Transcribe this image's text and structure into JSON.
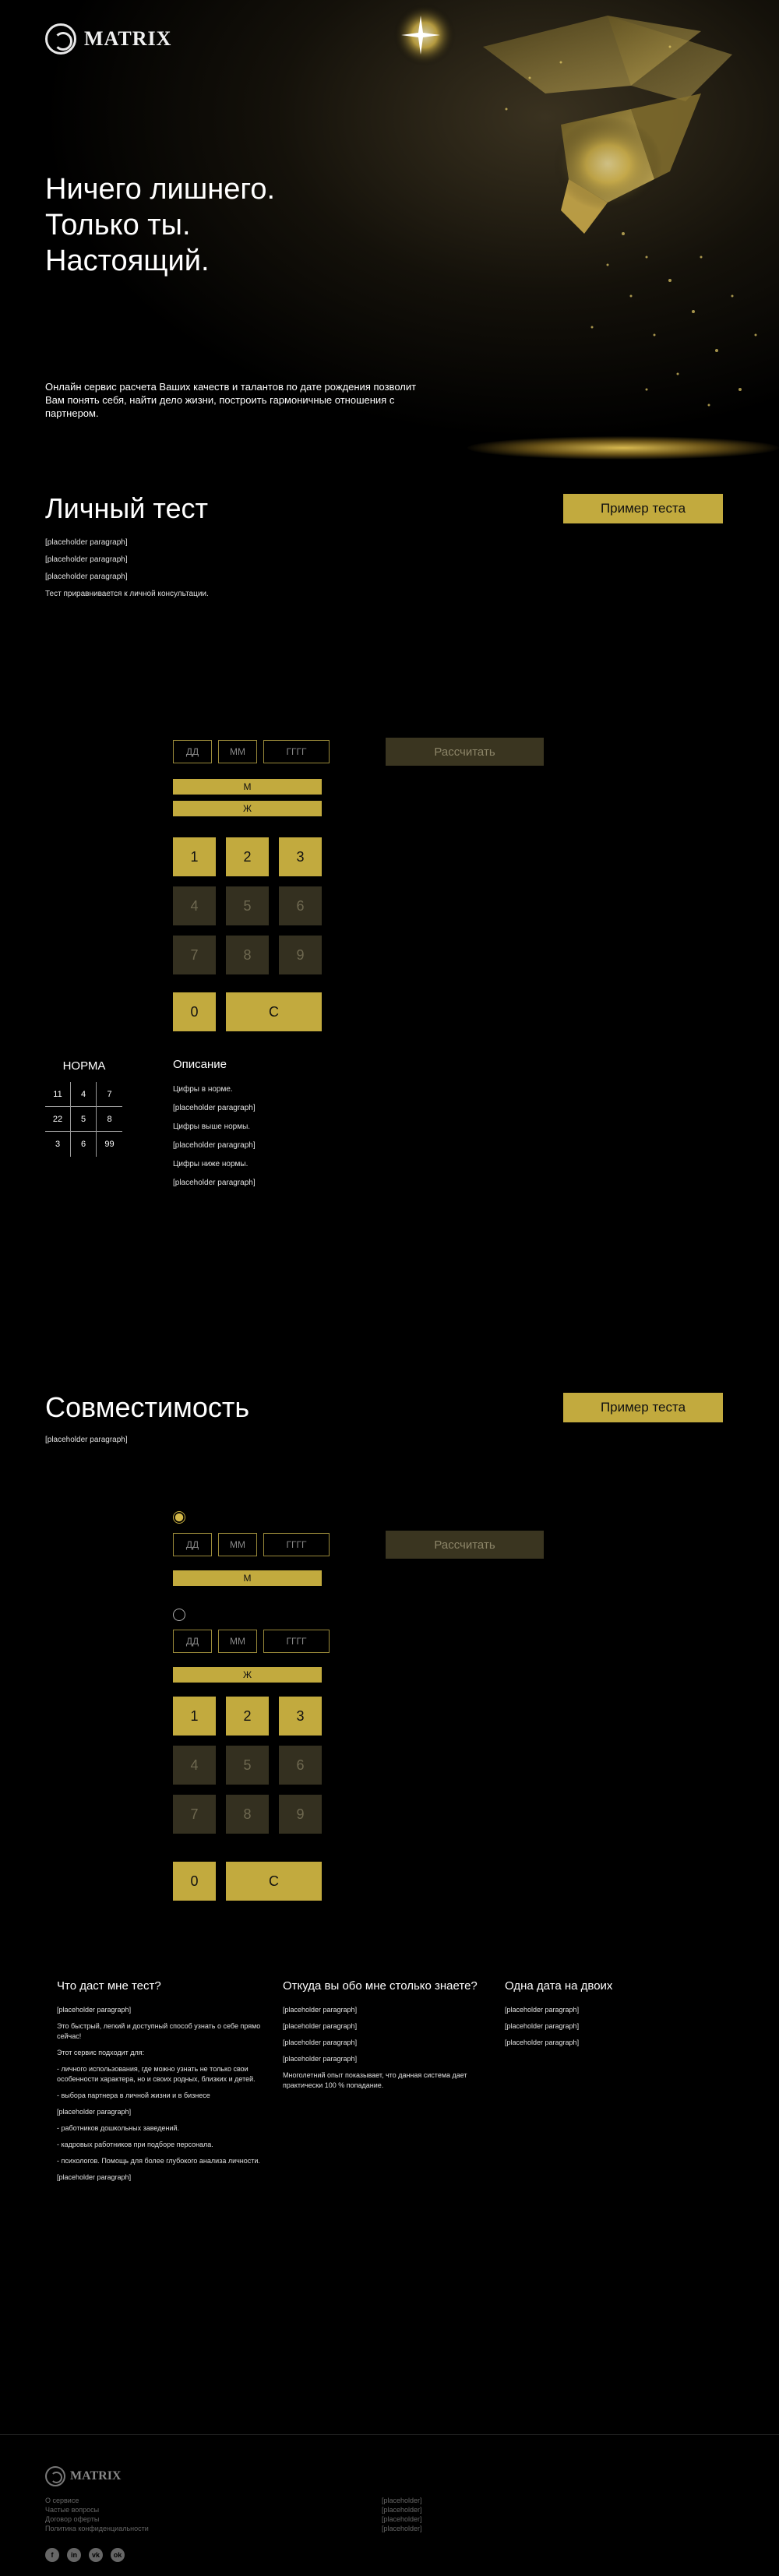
{
  "brand": {
    "name": "MATRIX"
  },
  "hero": {
    "title_lines": [
      "Ничего лишнего.",
      "Только ты.",
      "Настоящий."
    ],
    "subtitle": "Онлайн сервис расчета Ваших качеств и талантов по дате рождения позволит Вам понять себя, найти дело жизни, построить гармоничные отношения с партнером."
  },
  "personal_test": {
    "title": "Личный тест",
    "example_button": "Пример теста",
    "paragraphs": [
      "[placeholder paragraph]",
      "[placeholder paragraph]",
      "[placeholder paragraph]",
      "Тест приравнивается к личной консультации."
    ]
  },
  "calculator": {
    "day_placeholder": "ДД",
    "month_placeholder": "ММ",
    "year_placeholder": "ГГГГ",
    "calc_button": "Рассчитать",
    "male": "М",
    "female": "Ж",
    "keys": [
      "1",
      "2",
      "3",
      "4",
      "5",
      "6",
      "7",
      "8",
      "9"
    ],
    "zero": "0",
    "clear": "C"
  },
  "norma": {
    "title": "НОРМА",
    "cells": [
      "11",
      "4",
      "7",
      "22",
      "5",
      "8",
      "3",
      "6",
      "99"
    ]
  },
  "description": {
    "title": "Описание",
    "items": [
      "Цифры в норме.",
      "[placeholder paragraph]",
      "Цифры выше нормы.",
      "[placeholder paragraph]",
      "Цифры ниже нормы.",
      "[placeholder paragraph]"
    ]
  },
  "compatibility": {
    "title": "Совместимость",
    "example_button": "Пример теста",
    "text": "[placeholder paragraph]"
  },
  "columns": [
    {
      "title": "Что даст мне тест?",
      "paragraphs": [
        "[placeholder paragraph]",
        "Это быстрый, легкий и доступный способ узнать о себе прямо сейчас!",
        "Этот сервис подходит для:",
        "- личного использования, где можно узнать не только свои особенности характера, но и своих родных, близких и детей.",
        "- выбора партнера в личной жизни и в бизнесе",
        "[placeholder paragraph]",
        "- работников дошкольных заведений.",
        "- кадровых работников при подборе персонала.",
        "- психологов. Помощь для более глубокого анализа личности.",
        "[placeholder paragraph]"
      ]
    },
    {
      "title": "Откуда вы обо мне столько знаете?",
      "paragraphs": [
        "[placeholder paragraph]",
        "[placeholder paragraph]",
        "[placeholder paragraph]",
        "[placeholder paragraph]",
        "Многолетний опыт показывает, что данная система дает практически 100 % попадание."
      ]
    },
    {
      "title": "Одна дата на двоих",
      "paragraphs": [
        "[placeholder paragraph]",
        "[placeholder paragraph]",
        "[placeholder paragraph]"
      ]
    }
  ],
  "footer": {
    "links": [
      "О сервисе",
      "Частые вопросы",
      "Договор оферты",
      "Политика конфиденциальности"
    ],
    "contacts": [
      "[placeholder]",
      "[placeholder]",
      "[placeholder]",
      "[placeholder]"
    ],
    "socials": [
      "f",
      "in",
      "vk",
      "ok"
    ]
  }
}
